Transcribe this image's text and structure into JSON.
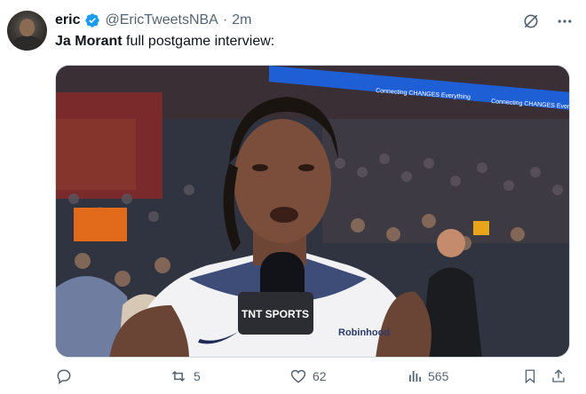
{
  "tweet": {
    "author_name": "eric",
    "handle": "@EricTweetsNBA",
    "separator": "·",
    "time": "2m",
    "text_bold": "Ja Morant",
    "text_rest": " full postgame interview:"
  },
  "media": {
    "banner_text_1": "Connecting CHANGES Everything",
    "banner_text_2": "Connecting CHANGES Everything",
    "mic_brand": "TNT SPORTS",
    "jersey_sponsor": "Robinhood"
  },
  "actions": {
    "replies": "",
    "reposts": "5",
    "likes": "62",
    "views": "565"
  },
  "icons": {
    "verified": "verified-badge-icon",
    "grok": "grok-icon",
    "more": "more-icon",
    "reply": "reply-icon",
    "repost": "repost-icon",
    "like": "heart-icon",
    "views": "views-icon",
    "bookmark": "bookmark-icon",
    "share": "share-icon"
  },
  "colors": {
    "verified_blue": "#1d9bf0",
    "muted_text": "#536471",
    "primary_text": "#0f1419"
  }
}
